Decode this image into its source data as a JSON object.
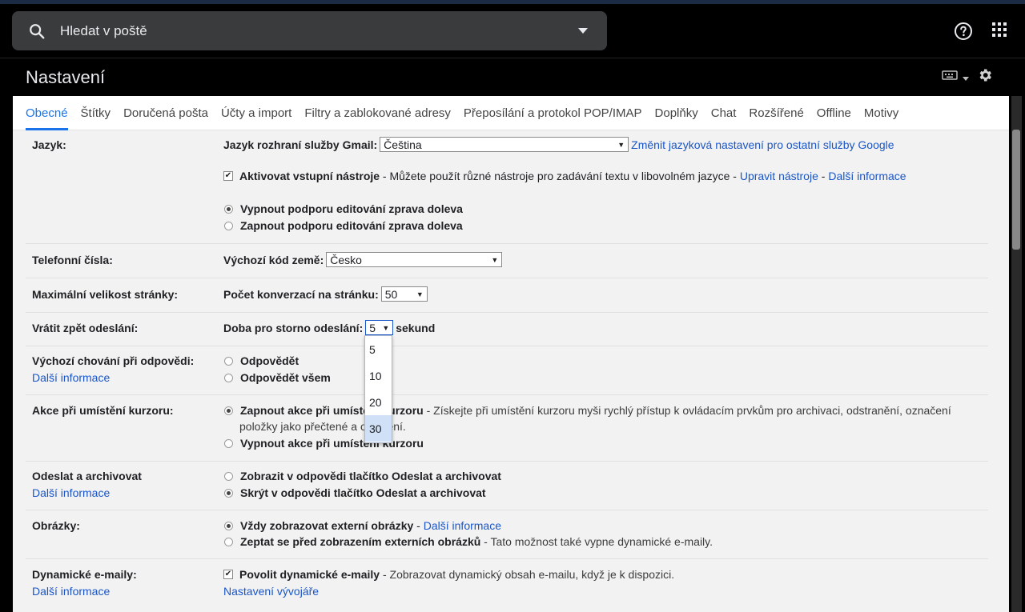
{
  "search": {
    "placeholder": "Hledat v poště"
  },
  "page": {
    "title": "Nastavení"
  },
  "tabs": [
    {
      "label": "Obecné"
    },
    {
      "label": "Štítky"
    },
    {
      "label": "Doručená pošta"
    },
    {
      "label": "Účty a import"
    },
    {
      "label": "Filtry a zablokované adresy"
    },
    {
      "label": "Přeposílání a protokol POP/IMAP"
    },
    {
      "label": "Doplňky"
    },
    {
      "label": "Chat"
    },
    {
      "label": "Rozšířené"
    },
    {
      "label": "Offline"
    },
    {
      "label": "Motivy"
    }
  ],
  "language": {
    "label": "Jazyk:",
    "ui_label": "Jazyk rozhraní služby Gmail:",
    "ui_value": "Čeština",
    "change_link": "Změnit jazyková nastavení pro ostatní služby Google",
    "input_tools": "Aktivovat vstupní nástroje",
    "input_tools_desc": " - Můžete použít různé nástroje pro zadávání textu v libovolném jazyce - ",
    "edit_tools": "Upravit nástroje",
    "sep": " - ",
    "more_info": "Další informace",
    "rtl_off": "Vypnout podporu editování zprava doleva",
    "rtl_on": "Zapnout podporu editování zprava doleva"
  },
  "phone": {
    "label": "Telefonní čísla:",
    "field_label": "Výchozí kód země:",
    "value": "Česko"
  },
  "page_size": {
    "label": "Maximální velikost stránky:",
    "field_label": "Počet konverzací na stránku:",
    "value": "50"
  },
  "undo": {
    "label": "Vrátit zpět odeslání:",
    "field_label": "Doba pro storno odeslání:",
    "value": "5",
    "unit": "sekund",
    "options": [
      "5",
      "10",
      "20",
      "30"
    ]
  },
  "reply": {
    "label": "Výchozí chování při odpovědi:",
    "more": "Další informace",
    "opt1": "Odpovědět",
    "opt2": "Odpovědět všem"
  },
  "hover": {
    "label": "Akce při umístění kurzoru:",
    "opt1": "Zapnout akce při umístění kurzoru",
    "opt1_desc": " - Získejte při umístění kurzoru myši rychlý přístup k ovládacím prvkům pro archivaci, odstranění, označení",
    "opt1_desc2": "položky jako přečtené a odložení.",
    "opt2": "Vypnout akce při umístění kurzoru"
  },
  "send_archive": {
    "label": "Odeslat a archivovat",
    "more": "Další informace",
    "opt1": "Zobrazit v odpovědi tlačítko Odeslat a archivovat",
    "opt2": "Skrýt v odpovědi tlačítko Odeslat a archivovat"
  },
  "images": {
    "label": "Obrázky:",
    "opt1": "Vždy zobrazovat externí obrázky",
    "sep": " - ",
    "more": "Další informace",
    "opt2": "Zeptat se před zobrazením externích obrázků",
    "opt2_desc": " - Tato možnost také vypne dynamické e-maily."
  },
  "dynamic": {
    "label": "Dynamické e-maily:",
    "more": "Další informace",
    "opt": "Povolit dynamické e-maily",
    "opt_desc": " - Zobrazovat dynamický obsah e-mailu, když je k dispozici.",
    "dev": "Nastavení vývojáře"
  },
  "colors": {
    "accent": "#1a73e8",
    "link": "#1a56c8",
    "dark_bg": "#000000",
    "panel_bg": "#f2f2f2"
  }
}
